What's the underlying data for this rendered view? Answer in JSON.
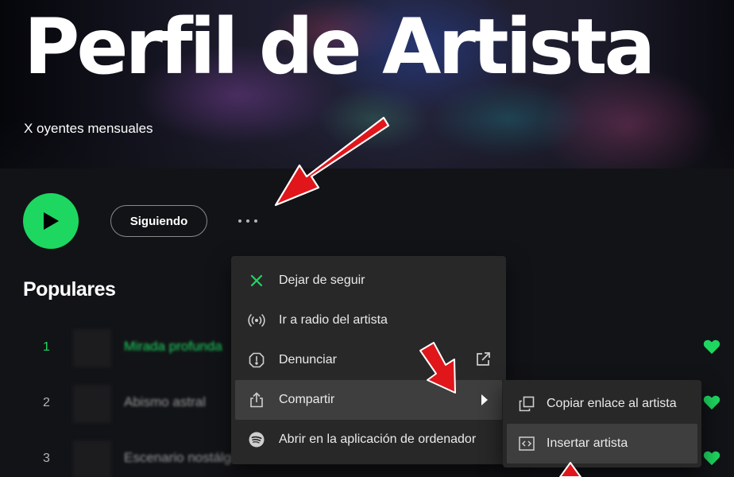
{
  "artist": {
    "name": "Perfil de Artista",
    "listeners": "X oyentes mensuales"
  },
  "actions": {
    "follow_label": "Siguiendo",
    "play_icon": "play-icon",
    "more_icon": "more-options-icon"
  },
  "popular": {
    "title": "Populares",
    "tracks": [
      {
        "number": "1",
        "name": "Mirada profunda",
        "active": true,
        "liked": true
      },
      {
        "number": "2",
        "name": "Abismo astral",
        "active": false,
        "liked": true
      },
      {
        "number": "3",
        "name": "Escenario nostálgico",
        "active": false,
        "liked": true
      }
    ]
  },
  "context_menu": {
    "items": [
      {
        "label": "Dejar de seguir",
        "icon": "close-icon"
      },
      {
        "label": "Ir a radio del artista",
        "icon": "radio-icon"
      },
      {
        "label": "Denunciar",
        "icon": "report-icon",
        "trailing_icon": "external-link-icon"
      },
      {
        "label": "Compartir",
        "icon": "share-icon",
        "trailing_icon": "submenu-arrow-icon",
        "highlighted": true
      },
      {
        "label": "Abrir en la aplicación de ordenador",
        "icon": "spotify-icon"
      }
    ]
  },
  "share_submenu": {
    "items": [
      {
        "label": "Copiar enlace al artista",
        "icon": "copy-icon"
      },
      {
        "label": "Insertar artista",
        "icon": "embed-icon",
        "highlighted": true
      }
    ]
  },
  "colors": {
    "accent": "#1ed760",
    "background": "#121317",
    "menu_bg": "#282828",
    "menu_hover": "#3e3e3e",
    "annotation": "#e0161b"
  }
}
